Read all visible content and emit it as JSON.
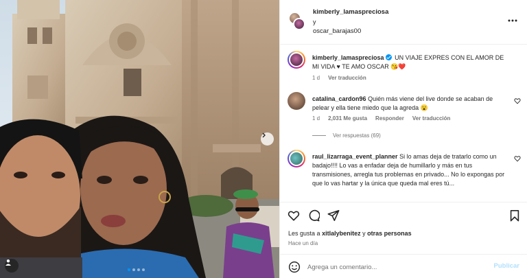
{
  "header": {
    "user1": "kimberly_lamaspreciosa",
    "conjunction": "y",
    "user2": "oscar_barajas00"
  },
  "caption": {
    "user": "kimberly_lamaspreciosa",
    "text": "UN VIAJE EXPRES CON EL AMOR DE MI VIDA ♥ TE AMO OSCAR 😘❤️",
    "time": "1 d",
    "translate": "Ver traducción"
  },
  "comments": [
    {
      "user": "catalina_cardon96",
      "text": "Quién más viene del live donde se acaban de pelear y ella tiene miedo que la agreda 😮",
      "time": "1 d",
      "likes": "2,031 Me gusta",
      "reply": "Responder",
      "translate": "Ver traducción",
      "view_replies": "Ver respuestas (69)"
    },
    {
      "user": "raul_lizarraga_event_planner",
      "text": "Si lo amas deja de tratarlo como un badajo!!!! Lo vas a enfadar deja de humillarlo y más en tus transmisiones, arregla tus problemas en privado... No lo expongas por que lo vas hartar y la única que queda mal eres tú..."
    }
  ],
  "likes": {
    "prefix": "Les gusta a",
    "user": "xitlalybenitez",
    "middle": "y",
    "others": "otras personas"
  },
  "time_ago": "Hace un día",
  "composer": {
    "placeholder": "Agrega un comentario...",
    "publish": "Publicar"
  },
  "carousel": {
    "total_slides": 4,
    "active_slide": 1
  },
  "icons": {
    "header_more": "more-horizontal-icon",
    "like": "heart-icon",
    "comment": "comment-icon",
    "share": "share-icon",
    "save": "bookmark-icon",
    "emoji": "emoji-icon",
    "next": "chevron-right-icon",
    "tags": "user-tag-icon",
    "comment_like": "heart-icon"
  },
  "colors": {
    "accent": "#0095f6",
    "publish_disabled": "#b2dffc",
    "secondary_text": "#737373",
    "primary_text": "#262626",
    "border": "#efefef"
  }
}
